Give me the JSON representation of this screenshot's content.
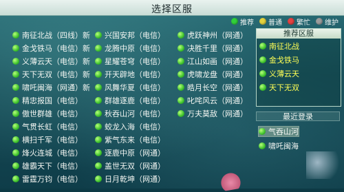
{
  "title": "选择区服",
  "legend": {
    "items": [
      {
        "label": "推荐",
        "color": "#31d13a"
      },
      {
        "label": "普通",
        "color": "#e4d33e"
      },
      {
        "label": "繁忙",
        "color": "#e44242"
      },
      {
        "label": "维护",
        "color": "#9d9d9d"
      }
    ]
  },
  "servers": {
    "col1": [
      "南征北战（四线）新",
      "金戈铁马（电信）新",
      "义薄云天（电信）新",
      "天下无双（电信）新",
      "啸吒闽海（网通）新",
      "精忠报国（电信）",
      "傲世群雄（电信）",
      "气贯长虹（电信）",
      "横扫千军（电信）",
      "烽火连城（电信）",
      "雄霸天下（电信）",
      "雷霆万钧（电信）"
    ],
    "col2": [
      "兴国安邦（电信）",
      "龙腾中原（电信）",
      "星耀苍穹（电信）",
      "开天辟地（电信）",
      "风舞华夏（电信）",
      "群雄逐鹿（电信）",
      "秋吞山河（电信）",
      "蛟龙入海（电信）",
      "紫气东来（电信）",
      "逐鹿中原（网通）",
      "盖世无双（网通）",
      "日月乾坤（网通）"
    ],
    "col3": [
      "虎跃神州（网通）",
      "决胜千里（网通）",
      "江山如画（网通）",
      "虎啸龙盘（网通）",
      "皓月长空（网通）",
      "叱咤风云（网通）",
      "万夫莫敌（网通）"
    ]
  },
  "recommended": {
    "header": "推荐区服",
    "items": [
      "南征北战",
      "金戈铁马",
      "义薄云天",
      "天下无双"
    ]
  },
  "recent": {
    "header": "最近登录",
    "items": [
      "气吞山河",
      "啸吒闽海"
    ]
  }
}
